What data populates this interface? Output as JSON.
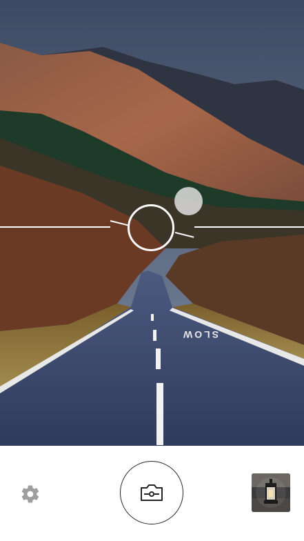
{
  "camera": {
    "viewfinder_scene": "mountain-road-preview",
    "road_marking_text": "SLOW"
  },
  "controls": {
    "settings_icon": "gear-icon",
    "shutter_icon": "camera-icon",
    "gallery_icon": "lantern-thumbnail"
  },
  "colors": {
    "background": "#ffffff",
    "overlay": "#ffffff",
    "icon": "#9e9e9e",
    "shutter_icon": "#222222"
  }
}
